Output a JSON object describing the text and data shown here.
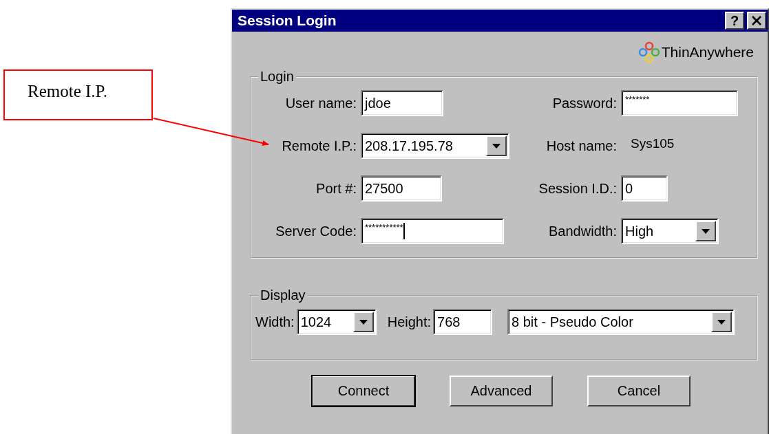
{
  "callout": {
    "text": "Remote I.P."
  },
  "window": {
    "title": "Session Login",
    "help_button": "?"
  },
  "logo": {
    "text": "ThinAnywhere"
  },
  "login": {
    "legend": "Login",
    "fields": [
      {
        "label": "User name:",
        "kind": "text",
        "value": "jdoe",
        "focused": false
      },
      {
        "label": "Password:",
        "kind": "text",
        "value": "*******",
        "focused": false
      },
      {
        "label": "Remote I.P.:",
        "kind": "combo",
        "value": "208.17.195.78",
        "focused": false
      },
      {
        "label": "Host name:",
        "kind": "static",
        "value": "Sys105",
        "focused": false
      },
      {
        "label": "Port #:",
        "kind": "text",
        "value": "27500",
        "focused": false
      },
      {
        "label": "Session I.D.:",
        "kind": "text",
        "value": "0",
        "focused": false
      },
      {
        "label": "Server Code:",
        "kind": "text",
        "value": "***********",
        "focused": true
      },
      {
        "label": "Bandwidth:",
        "kind": "combo",
        "value": "High",
        "focused": false
      }
    ]
  },
  "display": {
    "legend": "Display",
    "width_label": "Width:",
    "width_value": "1024",
    "height_label": "Height:",
    "height_value": "768",
    "color_depth": "8 bit - Pseudo Color"
  },
  "buttons": [
    {
      "label": "Connect",
      "default": true
    },
    {
      "label": "Advanced",
      "default": false
    },
    {
      "label": "Cancel",
      "default": false
    }
  ]
}
